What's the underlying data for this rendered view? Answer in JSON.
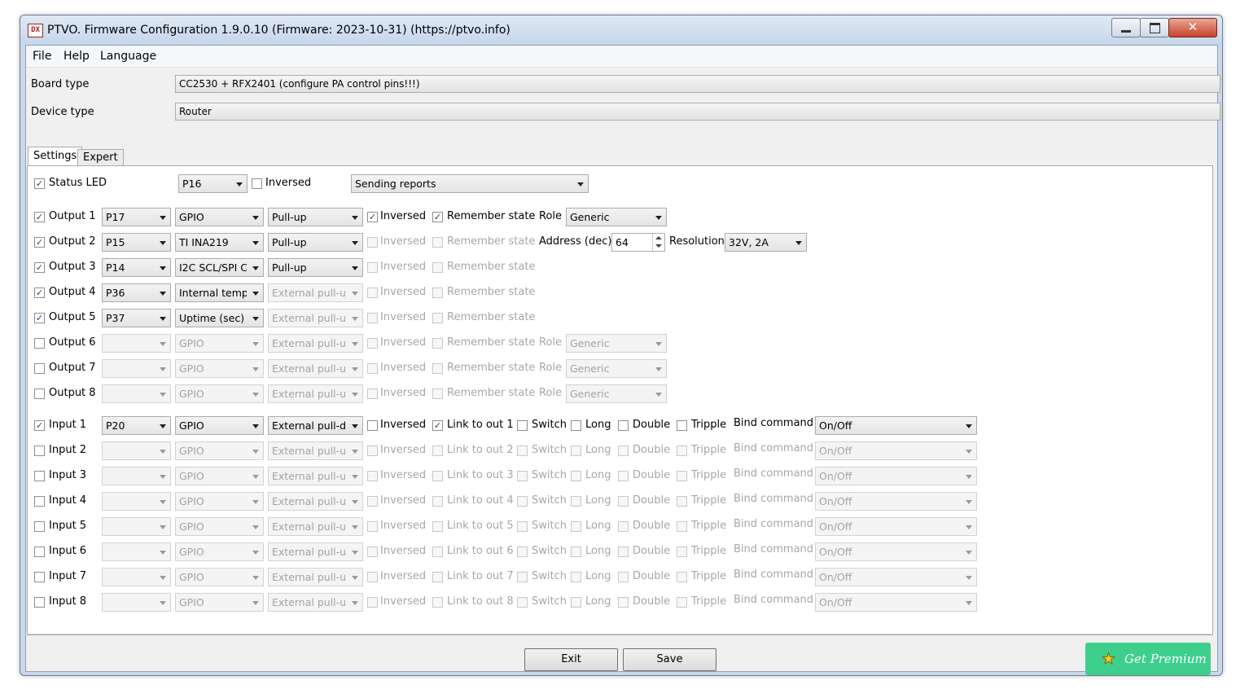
{
  "window": {
    "icon_text": "DX",
    "title": "PTVO. Firmware Configuration 1.9.0.10 (Firmware: 2023-10-31) (https://ptvo.info)",
    "close_glyph": "✕"
  },
  "menu": [
    "File",
    "Help",
    "Language"
  ],
  "board": {
    "label": "Board type",
    "value": "CC2530 + RFX2401 (configure PA control pins!!!)"
  },
  "device": {
    "label": "Device type",
    "value": "Router"
  },
  "tabs": [
    "Settings",
    "Expert"
  ],
  "check_glyph": "✓",
  "status_led": {
    "label": "Status LED",
    "checked": true,
    "pin": "P16",
    "inversed_label": "Inversed",
    "inversed": false,
    "mode": "Sending reports"
  },
  "outputs": [
    {
      "label": "Output 1",
      "checked": true,
      "pin": "P17",
      "type": "GPIO",
      "pull": "Pull-up",
      "inversed": true,
      "remember": true,
      "extra": "role",
      "role": "Generic"
    },
    {
      "label": "Output 2",
      "checked": true,
      "pin": "P15",
      "type": "TI INA219",
      "pull": "Pull-up",
      "inversed": false,
      "remember": false,
      "extra": "address",
      "address_label": "Address (dec)",
      "address": "64",
      "resolution_label": "Resolution",
      "resolution": "32V, 2A"
    },
    {
      "label": "Output 3",
      "checked": true,
      "pin": "P14",
      "type": "I2C SCL/SPI C",
      "pull": "Pull-up",
      "inversed": false,
      "remember": false,
      "extra": "none"
    },
    {
      "label": "Output 4",
      "checked": true,
      "pin": "P36",
      "type": "Internal tempe",
      "pull": "External pull-up",
      "inversed": false,
      "remember": false,
      "extra": "none"
    },
    {
      "label": "Output 5",
      "checked": true,
      "pin": "P37",
      "type": "Uptime (sec)",
      "pull": "External pull-up",
      "inversed": false,
      "remember": false,
      "extra": "none"
    },
    {
      "label": "Output 6",
      "checked": false,
      "pin": "",
      "type": "GPIO",
      "pull": "External pull-up",
      "inversed": false,
      "remember": false,
      "extra": "role",
      "role": "Generic"
    },
    {
      "label": "Output 7",
      "checked": false,
      "pin": "",
      "type": "GPIO",
      "pull": "External pull-up",
      "inversed": false,
      "remember": false,
      "extra": "role",
      "role": "Generic"
    },
    {
      "label": "Output 8",
      "checked": false,
      "pin": "",
      "type": "GPIO",
      "pull": "External pull-up",
      "inversed": false,
      "remember": false,
      "extra": "role",
      "role": "Generic"
    }
  ],
  "output_labels": {
    "inversed": "Inversed",
    "remember": "Remember state",
    "role": "Role"
  },
  "inputs": [
    {
      "label": "Input 1",
      "checked": true,
      "pin": "P20",
      "type": "GPIO",
      "pull": "External pull-down",
      "inversed": false,
      "link": "Link to out 1",
      "link_checked": true,
      "command": "On/Off"
    },
    {
      "label": "Input 2",
      "checked": false,
      "pin": "",
      "type": "GPIO",
      "pull": "External pull-up",
      "inversed": false,
      "link": "Link to out 2",
      "link_checked": false,
      "command": "On/Off"
    },
    {
      "label": "Input 3",
      "checked": false,
      "pin": "",
      "type": "GPIO",
      "pull": "External pull-up",
      "inversed": false,
      "link": "Link to out 3",
      "link_checked": false,
      "command": "On/Off"
    },
    {
      "label": "Input 4",
      "checked": false,
      "pin": "",
      "type": "GPIO",
      "pull": "External pull-up",
      "inversed": false,
      "link": "Link to out 4",
      "link_checked": false,
      "command": "On/Off"
    },
    {
      "label": "Input 5",
      "checked": false,
      "pin": "",
      "type": "GPIO",
      "pull": "External pull-up",
      "inversed": false,
      "link": "Link to out 5",
      "link_checked": false,
      "command": "On/Off"
    },
    {
      "label": "Input 6",
      "checked": false,
      "pin": "",
      "type": "GPIO",
      "pull": "External pull-up",
      "inversed": false,
      "link": "Link to out 6",
      "link_checked": false,
      "command": "On/Off"
    },
    {
      "label": "Input 7",
      "checked": false,
      "pin": "",
      "type": "GPIO",
      "pull": "External pull-up",
      "inversed": false,
      "link": "Link to out 7",
      "link_checked": false,
      "command": "On/Off"
    },
    {
      "label": "Input 8",
      "checked": false,
      "pin": "",
      "type": "GPIO",
      "pull": "External pull-up",
      "inversed": false,
      "link": "Link to out 8",
      "link_checked": false,
      "command": "On/Off"
    }
  ],
  "input_labels": {
    "inversed": "Inversed",
    "switch": "Switch",
    "long": "Long",
    "double": "Double",
    "tripple": "Tripple",
    "bind": "Bind command"
  },
  "buttons": {
    "exit": "Exit",
    "save": "Save",
    "premium": "Get Premium",
    "premium_icon": "★"
  },
  "colors": {
    "premium": "#3ecf8e",
    "star": "#f7d21b",
    "close": "#c7422b"
  }
}
